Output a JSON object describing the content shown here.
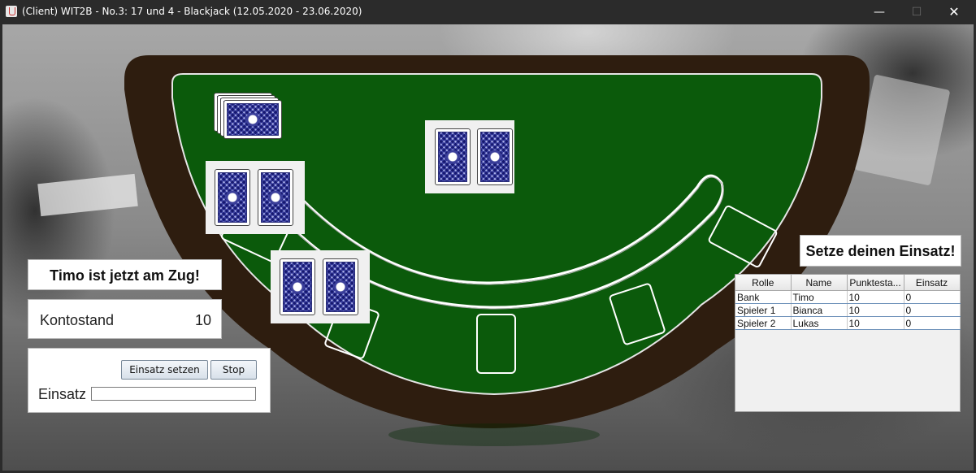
{
  "window": {
    "title": "(Client) WIT2B - No.3: 17 und 4 - Blackjack (12.05.2020 - 23.06.2020)",
    "minimize_glyph": "—",
    "maximize_glyph": "☐",
    "close_glyph": "✕"
  },
  "colors": {
    "felt": "#0b5a0b",
    "table_rim": "#2e1d0f",
    "card_back": "#3b3f9a",
    "titlebar": "#2b2b2b"
  },
  "status": {
    "turn_message": "Timo ist jetzt am Zug!",
    "bet_prompt": "Setze deinen Einsatz!"
  },
  "account": {
    "label": "Kontostand",
    "value": "10"
  },
  "bet": {
    "set_button": "Einsatz setzen",
    "stop_button": "Stop",
    "label": "Einsatz",
    "input_value": ""
  },
  "players_table": {
    "columns": [
      "Rolle",
      "Name",
      "Punktesta...",
      "Einsatz"
    ],
    "rows": [
      [
        "Bank",
        "Timo",
        "10",
        "0"
      ],
      [
        "Spieler 1",
        "Bianca",
        "10",
        "0"
      ],
      [
        "Spieler 2",
        "Lukas",
        "10",
        "0"
      ]
    ]
  },
  "icons": {
    "app": "java-icon",
    "deck": "card-deck-icon",
    "card_back": "card-back-icon"
  }
}
